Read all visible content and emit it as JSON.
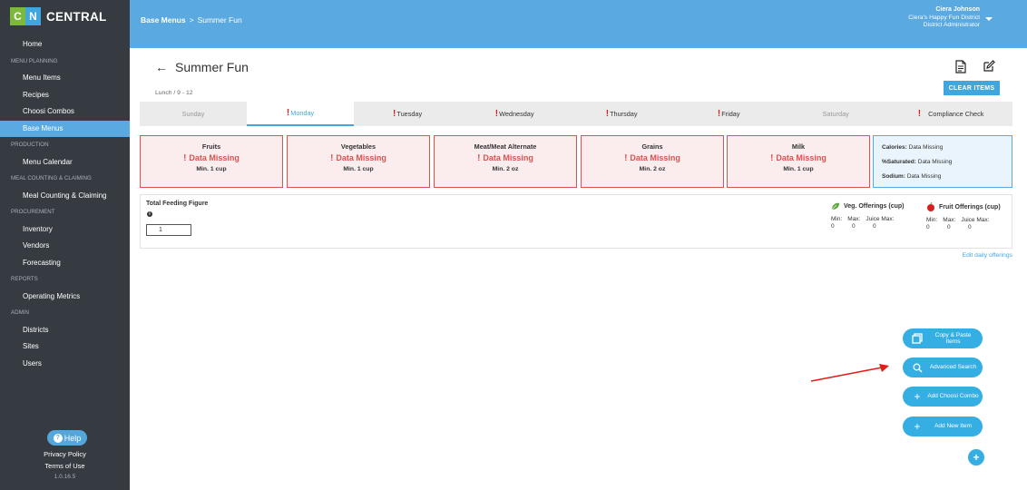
{
  "app": {
    "logo_c": "C",
    "logo_n": "N",
    "logo_text": "CENTRAL"
  },
  "sidebar": {
    "items": [
      {
        "type": "item",
        "label": "Home",
        "active": false
      },
      {
        "type": "section",
        "label": "MENU PLANNING"
      },
      {
        "type": "item",
        "label": "Menu Items",
        "active": false
      },
      {
        "type": "item",
        "label": "Recipes",
        "active": false
      },
      {
        "type": "item",
        "label": "Choosi Combos",
        "active": false
      },
      {
        "type": "item",
        "label": "Base Menus",
        "active": true
      },
      {
        "type": "section",
        "label": "PRODUCTION"
      },
      {
        "type": "item",
        "label": "Menu Calendar",
        "active": false
      },
      {
        "type": "section",
        "label": "MEAL COUNTING & CLAIMING"
      },
      {
        "type": "item",
        "label": "Meal Counting & Claiming",
        "active": false
      },
      {
        "type": "section",
        "label": "PROCUREMENT"
      },
      {
        "type": "item",
        "label": "Inventory",
        "active": false
      },
      {
        "type": "item",
        "label": "Vendors",
        "active": false
      },
      {
        "type": "item",
        "label": "Forecasting",
        "active": false
      },
      {
        "type": "section",
        "label": "REPORTS"
      },
      {
        "type": "item",
        "label": "Operating Metrics",
        "active": false
      },
      {
        "type": "section",
        "label": "ADMIN"
      },
      {
        "type": "item",
        "label": "Districts",
        "active": false
      },
      {
        "type": "item",
        "label": "Sites",
        "active": false
      },
      {
        "type": "item",
        "label": "Users",
        "active": false
      }
    ],
    "help_label": "Help",
    "privacy_label": "Privacy Policy",
    "terms_label": "Terms of Use",
    "version": "1.0.16.5"
  },
  "header": {
    "crumb_parent": "Base Menus",
    "crumb_separator": ">",
    "crumb_current": "Summer Fun",
    "user_name": "Ciera Johnson",
    "user_district": "Ciera's Happy Fun District",
    "user_role": "District Administrator"
  },
  "main": {
    "back_arrow": "←",
    "title": "Summer Fun",
    "meal_subtitle": "Lunch / 9 - 12",
    "clear_items_label": "CLEAR ITEMS",
    "tabs": [
      {
        "label": "Sunday",
        "warning": false,
        "active": false,
        "weekend": true
      },
      {
        "label": "Monday",
        "warning": true,
        "active": true,
        "weekend": false
      },
      {
        "label": "Tuesday",
        "warning": true,
        "active": false,
        "weekend": false
      },
      {
        "label": "Wednesday",
        "warning": true,
        "active": false,
        "weekend": false
      },
      {
        "label": "Thursday",
        "warning": true,
        "active": false,
        "weekend": false
      },
      {
        "label": "Friday",
        "warning": true,
        "active": false,
        "weekend": false
      },
      {
        "label": "Saturday",
        "warning": false,
        "active": false,
        "weekend": true
      },
      {
        "label": "Compliance Check",
        "warning": true,
        "active": false,
        "weekend": false
      }
    ],
    "components": [
      {
        "name": "Fruits",
        "status": "Data Missing",
        "min": "Min. 1 cup"
      },
      {
        "name": "Vegetables",
        "status": "Data Missing",
        "min": "Min. 1 cup"
      },
      {
        "name": "Meat/Meat Alternate",
        "status": "Data Missing",
        "min": "Min. 2 oz"
      },
      {
        "name": "Grains",
        "status": "Data Missing",
        "min": "Min. 2 oz"
      },
      {
        "name": "Milk",
        "status": "Data Missing",
        "min": "Min. 1 cup"
      }
    ],
    "nutrition": {
      "calories_label": "Calories:",
      "calories_value": "Data Missing",
      "saturated_label": "%Saturated:",
      "saturated_value": "Data Missing",
      "sodium_label": "Sodium:",
      "sodium_value": "Data Missing"
    },
    "feeding": {
      "title": "Total Feeding Figure",
      "info_icon": "i",
      "value": "1"
    },
    "veg_offerings": {
      "title": "Veg. Offerings (cup)",
      "min_label": "Min:",
      "max_label": "Max:",
      "juice_label": "Juice Max:",
      "min": "0",
      "max": "0",
      "juice": "0"
    },
    "fruit_offerings": {
      "title": "Fruit Offerings (cup)",
      "min_label": "Min:",
      "max_label": "Max:",
      "juice_label": "Juice Max:",
      "min": "0",
      "max": "0",
      "juice": "0"
    },
    "edit_daily_label": "Edit daily offerings",
    "fabs": {
      "copy_paste": "Copy & Paste Items",
      "advanced_search": "Advanced Search",
      "add_choosi": "Add Choosi Combo",
      "add_new_item": "Add New Item"
    }
  },
  "colors": {
    "accent": "#5aa9e0",
    "sidebar_bg": "#353b41",
    "warning": "#d9534f",
    "annotation_arrow": "#e21b1b"
  }
}
